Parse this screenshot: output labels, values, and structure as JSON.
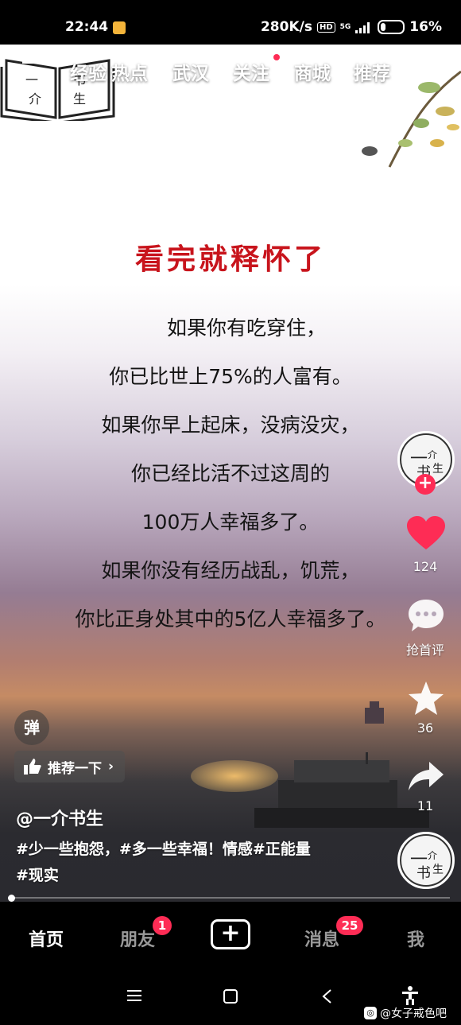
{
  "status": {
    "time": "22:44",
    "speed": "280K/s",
    "hd": "HD",
    "net": "5G",
    "battery": "16%"
  },
  "top_tabs": [
    {
      "label": "经验"
    },
    {
      "label": "热点"
    },
    {
      "label": "武汉"
    },
    {
      "label": "关注"
    },
    {
      "label": "商城"
    },
    {
      "label": "推荐"
    }
  ],
  "logo_text": [
    "一",
    "介",
    "书",
    "生"
  ],
  "video": {
    "headline": "看完就释怀了",
    "lines": [
      "如果你有吃穿住，",
      "你已比世上75%的人富有。",
      "如果你早上起床，没病没灾，",
      "你已经比活不过这周的",
      "100万人幸福多了。",
      "如果你没有经历战乱，饥荒，",
      "你比正身处其中的5亿人幸福多了。"
    ]
  },
  "side": {
    "likes": "124",
    "comment_label": "抢首评",
    "favorites": "36",
    "shares": "11"
  },
  "danmu_label": "弹",
  "recommend_label": "推荐一下",
  "author": "@一介书生",
  "caption_line1": "#少一些抱怨，#多一些幸福！情感#正能量",
  "caption_line2": "#现实",
  "bottom_tabs": {
    "home": "首页",
    "friends": "朋友",
    "friends_badge": "1",
    "messages": "消息",
    "messages_badge": "25",
    "me": "我"
  },
  "watermark": "@女子戒色吧"
}
